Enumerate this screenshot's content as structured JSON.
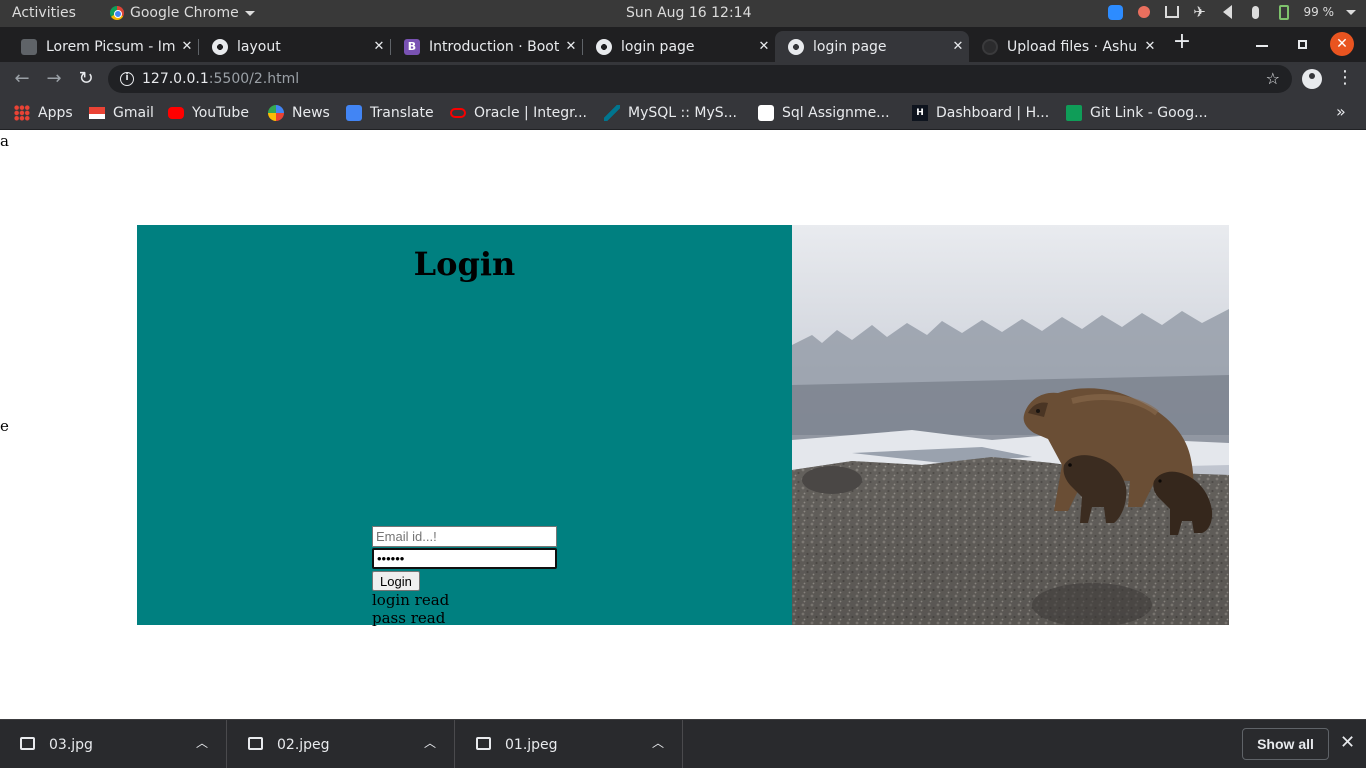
{
  "system_bar": {
    "activities": "Activities",
    "app_name": "Google Chrome",
    "clock": "Sun Aug 16  12:14",
    "battery": "99 %"
  },
  "tabs": [
    {
      "title": "Lorem Picsum - Ima",
      "icon": "picsum-icon",
      "active": false
    },
    {
      "title": "layout",
      "icon": "globe-icon",
      "active": false
    },
    {
      "title": "Introduction · Boot",
      "icon": "bootstrap-icon",
      "active": false
    },
    {
      "title": "login page",
      "icon": "globe-icon",
      "active": false
    },
    {
      "title": "login page",
      "icon": "globe-icon",
      "active": true
    },
    {
      "title": "Upload files · Ashu",
      "icon": "github-icon",
      "active": false
    }
  ],
  "address_bar": {
    "host": "127.0.0.1",
    "path": ":5500/2.html"
  },
  "bookmarks": [
    {
      "label": "Apps",
      "icon": "apps-grid-icon"
    },
    {
      "label": "Gmail",
      "icon": "gmail-icon"
    },
    {
      "label": "YouTube",
      "icon": "youtube-icon"
    },
    {
      "label": "News",
      "icon": "news-icon"
    },
    {
      "label": "Translate",
      "icon": "translate-icon"
    },
    {
      "label": "Oracle | Integr...",
      "icon": "oracle-icon"
    },
    {
      "label": "MySQL :: MyS...",
      "icon": "mysql-icon"
    },
    {
      "label": "Sql Assignme...",
      "icon": "sql-icon"
    },
    {
      "label": "Dashboard | H...",
      "icon": "hackerrank-icon"
    },
    {
      "label": "Git Link - Goog...",
      "icon": "sheets-icon"
    }
  ],
  "page": {
    "stray_top": "a",
    "stray_mid": "e",
    "login_title": "Login",
    "email_placeholder": "Email id...!",
    "password_value": "••••••",
    "login_button": "Login",
    "status_login": "login read",
    "status_pass": "pass read",
    "panel_color": "#008080"
  },
  "downloads": [
    {
      "filename": "03.jpg"
    },
    {
      "filename": "02.jpeg"
    },
    {
      "filename": "01.jpeg"
    }
  ],
  "download_shelf": {
    "show_all": "Show all"
  }
}
